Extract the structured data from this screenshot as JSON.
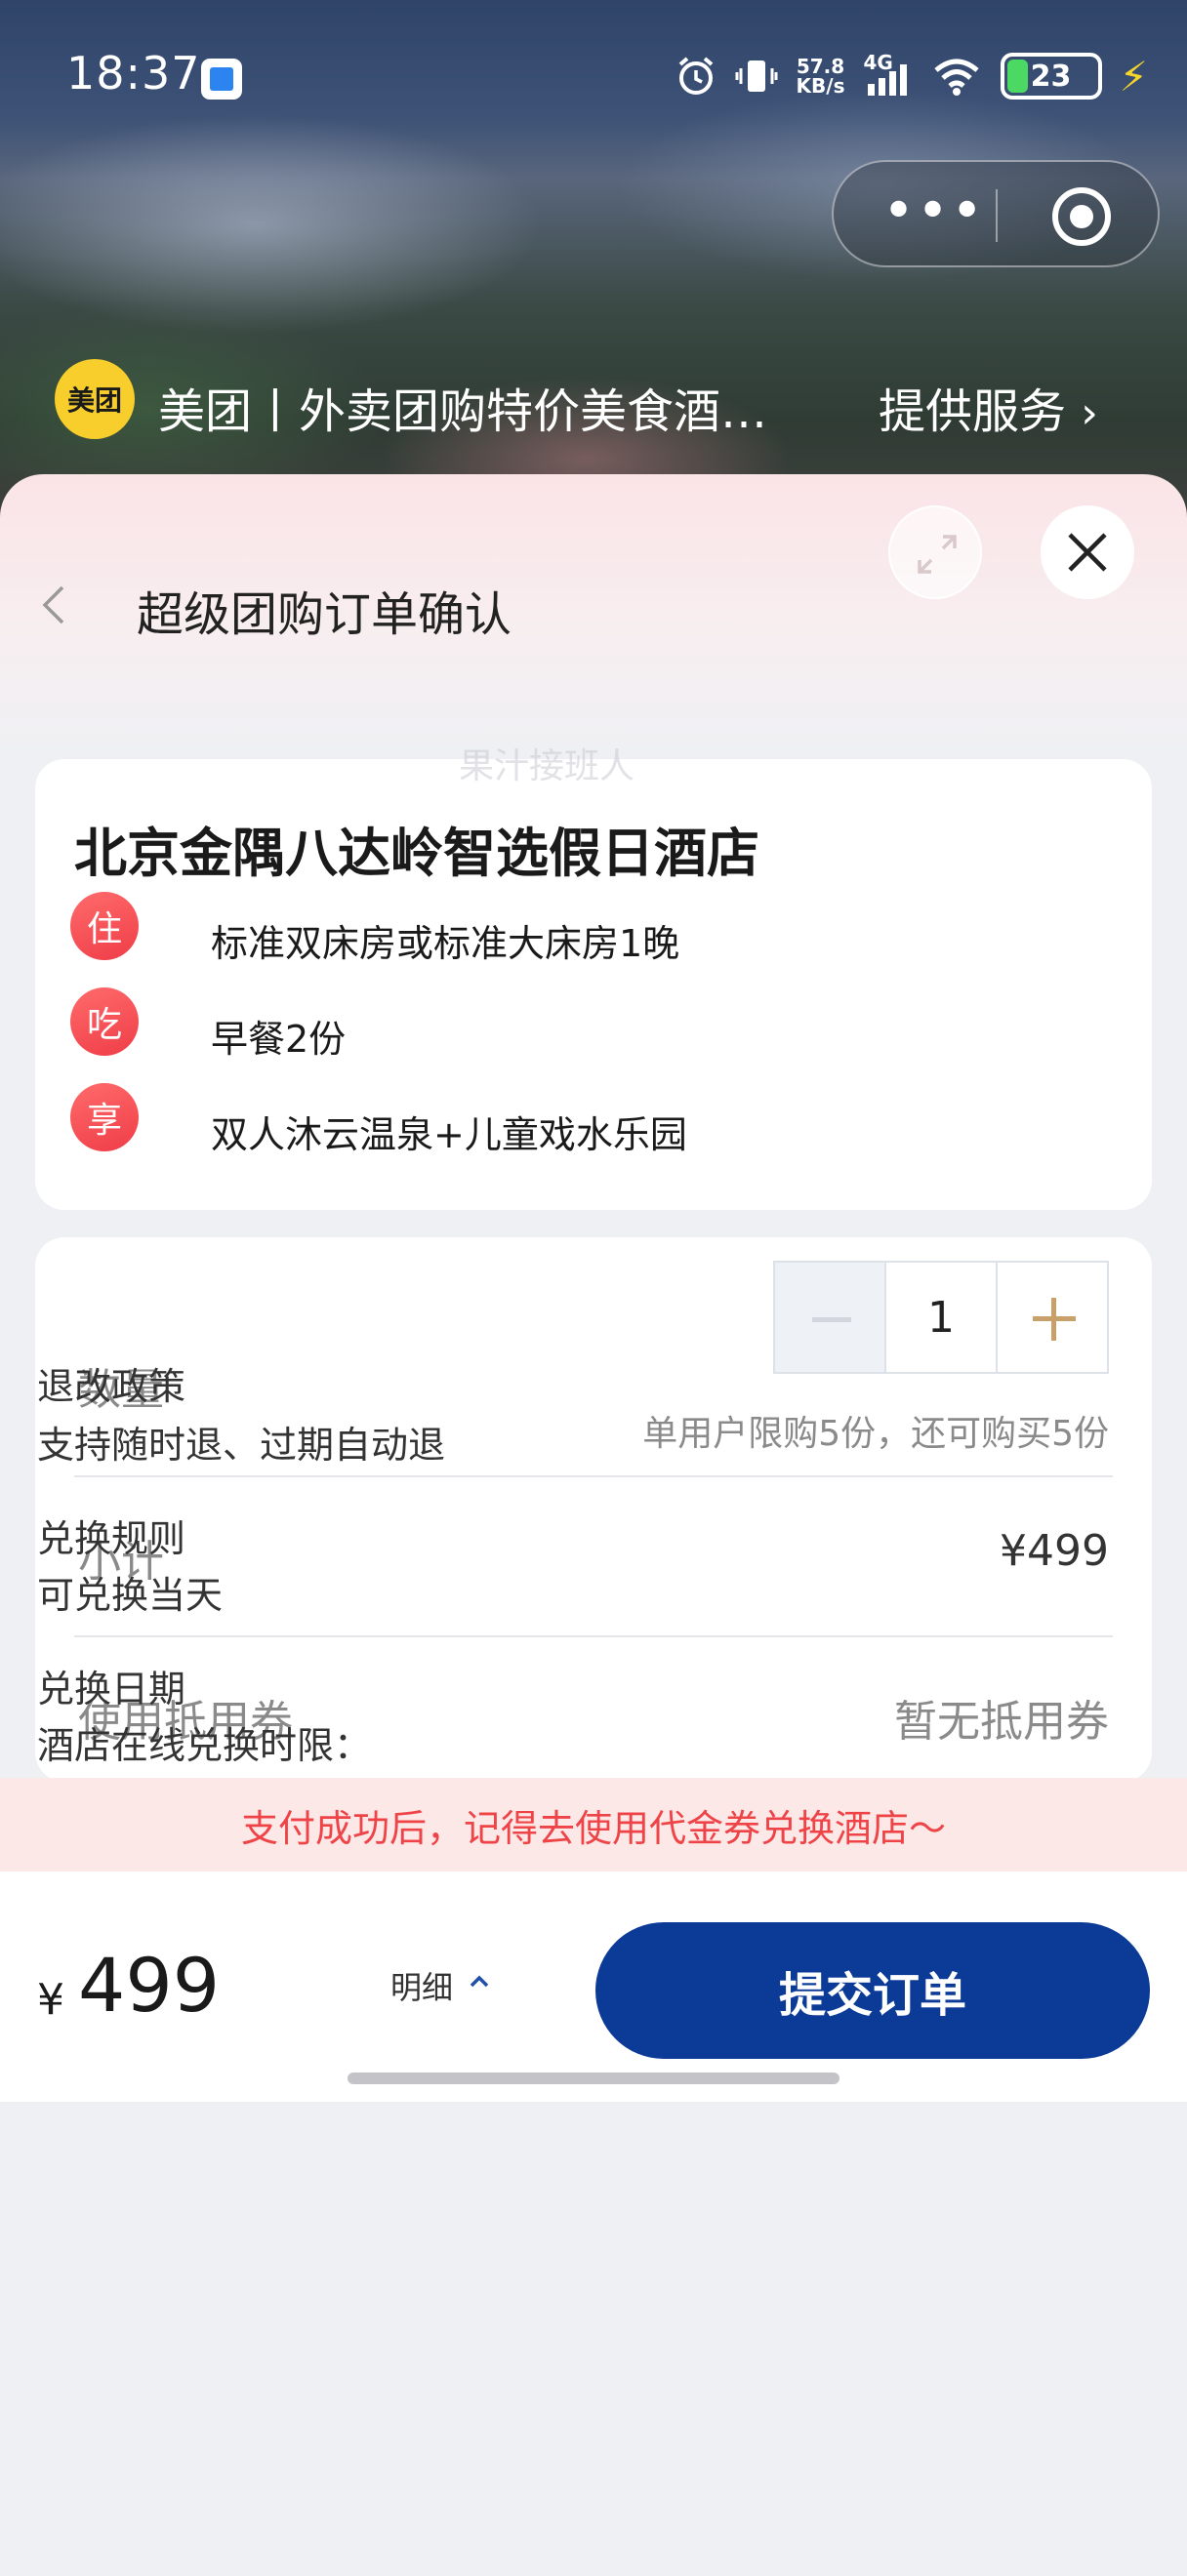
{
  "status_bar": {
    "time": "18:37",
    "network_speed": "57.8",
    "network_unit": "KB/s",
    "network_type": "4G",
    "battery": "23",
    "icons": [
      "alarm-icon",
      "vibrate-icon",
      "signal-icon",
      "wifi-icon",
      "battery-icon",
      "charging-icon"
    ]
  },
  "mini_program": {
    "logo_text": "美团",
    "title": "美团丨外卖团购特价美食酒…",
    "service": "提供服务"
  },
  "page": {
    "title": "超级团购订单确认"
  },
  "hotel": {
    "name": "北京金隅八达岭智选假日酒店",
    "features": [
      {
        "badge": "住",
        "text": "标准双床房或标准大床房1晚"
      },
      {
        "badge": "吃",
        "text": "早餐2份"
      },
      {
        "badge": "享",
        "text": "双人沐云温泉+儿童戏水乐园"
      }
    ]
  },
  "watermark": "果汁接班人",
  "order": {
    "quantity_label": "数量",
    "quantity": "1",
    "limit_note": "单用户限购5份，还可购买5份",
    "subtotal_label": "小计",
    "subtotal_value": "¥499",
    "coupon_label": "使用抵用券",
    "coupon_value": "暂无抵用券"
  },
  "policies": [
    {
      "title": "退改政策",
      "text": "支持随时退、过期自动退"
    },
    {
      "title": "兑换规则",
      "text": "可兑换当天"
    },
    {
      "title": "兑换日期",
      "text": "酒店在线兑换时限："
    }
  ],
  "notice": "支付成功后，记得去使用代金券兑换酒店～",
  "bottom": {
    "currency": "¥",
    "total": "499",
    "detail_label": "明细",
    "submit_label": "提交订单"
  },
  "colors": {
    "accent_red": "#ee4448",
    "submit_blue": "#0b3b96",
    "stepper_plus": "#c8a06a",
    "logo_yellow": "#f7ce2c"
  }
}
